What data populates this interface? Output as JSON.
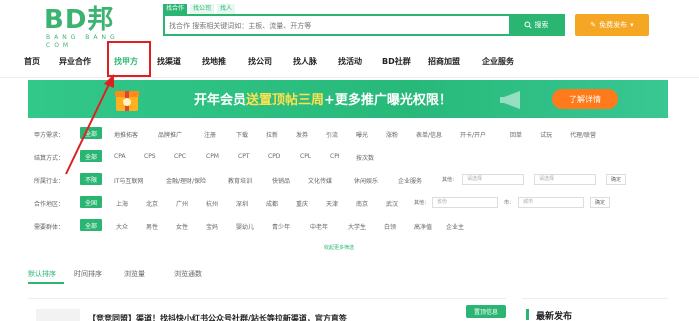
{
  "header": {
    "logo": "BD邦",
    "logo_sub": "BANG  BANG  COM",
    "search_tabs": [
      "找合作",
      "找公司",
      "找人"
    ],
    "search_placeholder": "找合作 搜索相关键词如：主板、流量、开方等",
    "search_button": "搜索",
    "publish_button": "免费发布"
  },
  "nav": {
    "items": [
      "首页",
      "异业合作",
      "找甲方",
      "找渠道",
      "找地推",
      "找公司",
      "找人脉",
      "找活动",
      "BD社群",
      "招商加盟",
      "企业服务"
    ],
    "active_index": 2
  },
  "banner": {
    "text_prefix": "开年会员",
    "text_highlight": "送置顶帖三周",
    "text_suffix": "+更多推广曝光权限！",
    "button": "了解详情"
  },
  "filters": {
    "rows": [
      {
        "label": "甲方需求：",
        "all": "全部",
        "options": [
          "地推拓客",
          "品牌推广",
          "注册",
          "下载",
          "拉新",
          "发券",
          "引流",
          "曝光",
          "涨粉",
          "表单/信息",
          "开卡/开户",
          "回单",
          "试玩",
          "代理/联营"
        ]
      },
      {
        "label": "结算方式：",
        "all": "全部",
        "options": [
          "CPA",
          "CPS",
          "CPC",
          "CPM",
          "CPT",
          "CPD",
          "CPL",
          "CPI",
          "按次数"
        ]
      },
      {
        "label": "所属行业：",
        "all": "不限",
        "options": [
          "IT与互联网",
          "金融/理财/保险",
          "教育培训",
          "快销品",
          "文化传媒",
          "休闲娱乐",
          "企业服务"
        ],
        "select_label_1": "其他：",
        "select_1": "请选择",
        "select_2": "请选择",
        "confirm": "确定"
      },
      {
        "label": "合作地区：",
        "all": "全国",
        "options": [
          "上海",
          "北京",
          "广州",
          "杭州",
          "深圳",
          "成都",
          "重庆",
          "天津",
          "南京",
          "武汉"
        ],
        "select_label_1": "其他：",
        "select_1": "省份",
        "select_label_2": "市：",
        "select_2": "城市",
        "confirm": "确定"
      },
      {
        "label": "需要群体：",
        "all": "全部",
        "options": [
          "大众",
          "男性",
          "女性",
          "宝妈",
          "婴幼儿",
          "青少年",
          "中老年",
          "大学生",
          "白领",
          "高净值",
          "企业主"
        ]
      }
    ],
    "more_link": "收起更多筛选"
  },
  "sort": {
    "items": [
      "默认排序",
      "时间排序",
      "浏览量",
      "浏览通数"
    ]
  },
  "card": {
    "title": "【竞竞同盟】渠道！找抖快小红书公众号社群/站长等拉新渠道，官方直签",
    "tag": "置顶信息"
  },
  "side": {
    "title": "最新发布"
  },
  "colors": {
    "accent": "#2bb573",
    "orange": "#f5a623",
    "highlight_box": "#e02020"
  }
}
